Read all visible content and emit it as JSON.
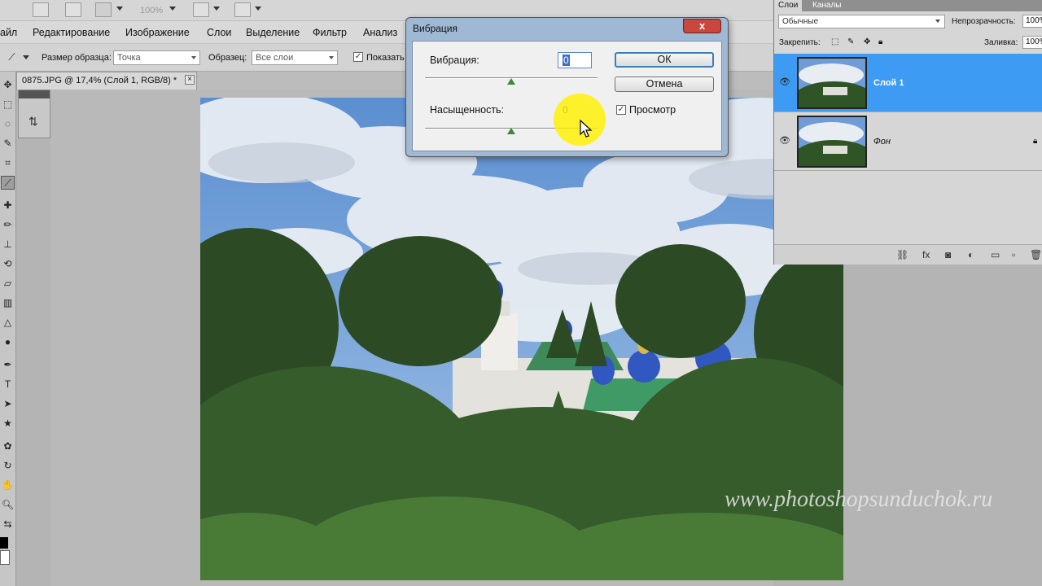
{
  "appbar": {
    "zoom": "100%"
  },
  "menu": [
    {
      "label": "айл"
    },
    {
      "label": "Редактирование"
    },
    {
      "label": "Изображение"
    },
    {
      "label": "Слои"
    },
    {
      "label": "Выделение"
    },
    {
      "label": "Фильтр"
    },
    {
      "label": "Анализ"
    }
  ],
  "options": {
    "sample_size_label": "Размер образца:",
    "sample_size_value": "Точка",
    "sample_label": "Образец:",
    "sample_value": "Все слои",
    "show_label": "Показать"
  },
  "document": {
    "tab_title": "0875.JPG @ 17,4% (Слой 1, RGB/8) *",
    "close": "×"
  },
  "watermark": "www.photoshopsunduchok.ru",
  "layers_panel": {
    "tabs": [
      "Слои",
      "Каналы"
    ],
    "blend_mode": "Обычные",
    "opacity_label": "Непрозрачность:",
    "opacity_value": "100%",
    "lock_label": "Закрепить:",
    "fill_label": "Заливка:",
    "fill_value": "100%",
    "layers": [
      {
        "name": "Слой 1",
        "selected": true
      },
      {
        "name": "Фон",
        "locked": true
      }
    ]
  },
  "dialog": {
    "title": "Вибрация",
    "close": "x",
    "vibrance_label": "Вибрация:",
    "vibrance_value": "0",
    "saturation_label": "Насыщенность:",
    "saturation_value": "0",
    "ok": "ОК",
    "cancel": "Отмена",
    "preview_label": "Просмотр",
    "preview_checked": true
  },
  "colors": {
    "selection_blue": "#3d9bf3",
    "slider_green": "#3b8a3b",
    "highlight": "#ffef00"
  }
}
